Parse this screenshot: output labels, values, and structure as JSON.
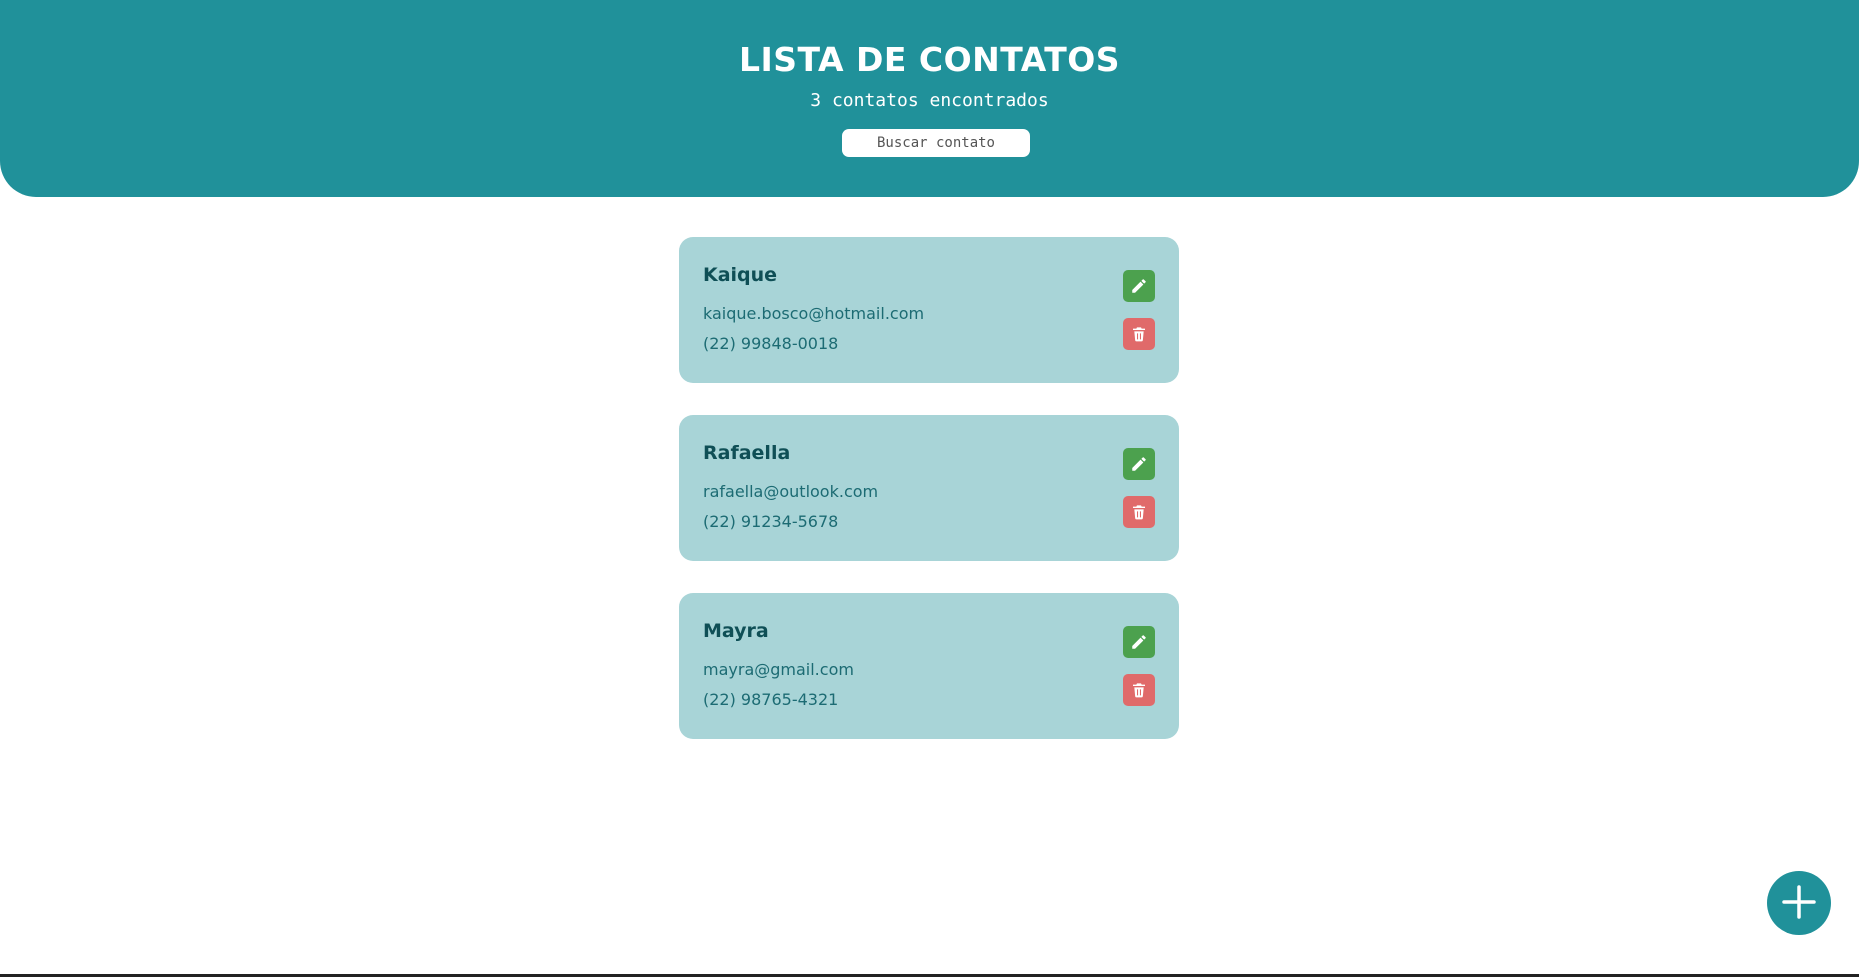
{
  "header": {
    "title": "LISTA DE CONTATOS",
    "count_text": "3 contatos encontrados",
    "search_placeholder": "Buscar contato",
    "search_value": ""
  },
  "contacts": [
    {
      "name": "Kaique",
      "email": "kaique.bosco@hotmail.com",
      "phone": "(22) 99848-0018"
    },
    {
      "name": "Rafaella",
      "email": "rafaella@outlook.com",
      "phone": "(22) 91234-5678"
    },
    {
      "name": "Mayra",
      "email": "mayra@gmail.com",
      "phone": "(22) 98765-4321"
    }
  ],
  "icons": {
    "edit": "pencil-icon",
    "delete": "trash-icon",
    "add": "plus-icon"
  },
  "colors": {
    "primary": "#20919a",
    "card_background": "#a8d4d7",
    "edit_button": "#4ca14e",
    "delete_button": "#e06a6a",
    "name_text": "#0f4f56",
    "detail_text": "#1c6b73"
  }
}
